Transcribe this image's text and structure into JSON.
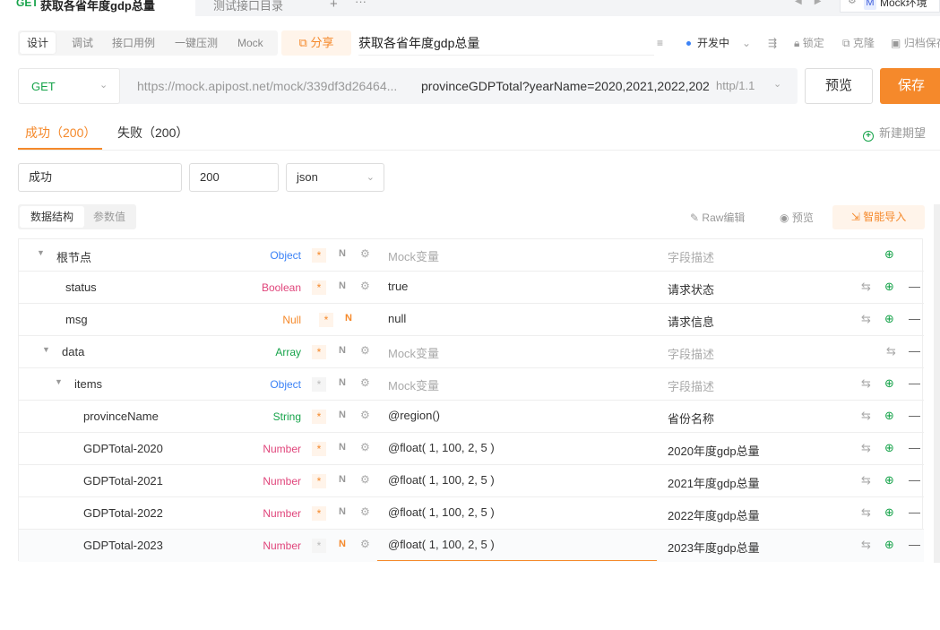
{
  "tabbar": {
    "active_method": "GET",
    "active_title": "获取各省年度gdp总量",
    "tab2_title": "测试接口目录",
    "plus": "+",
    "more": "···",
    "env_icon": "M",
    "env_name": "Mock环境"
  },
  "toolbar": {
    "subtabs": [
      "设计",
      "调试",
      "接口用例",
      "一键压测",
      "Mock"
    ],
    "share": "分享",
    "api_name": "获取各省年度gdp总量",
    "status": "开发中",
    "lock": "锁定",
    "clone": "克隆",
    "archive": "归档保存"
  },
  "urlbar": {
    "method": "GET",
    "host": "https://mock.apipost.net/mock/339df3d26464...",
    "path": "provinceGDPTotal?yearName=2020,2021,2022,202",
    "http_version": "http/1.1",
    "preview": "预览",
    "save": "保存"
  },
  "response": {
    "tabs": [
      "成功（200）",
      "失败（200）"
    ],
    "new_expect": "新建期望",
    "name": "成功",
    "code": "200",
    "format": "json",
    "seg": [
      "数据结构",
      "参数值"
    ],
    "raw_edit": "Raw编辑",
    "preview": "预览",
    "smart_import": "智能导入"
  },
  "colors": {
    "accent": "#f5892b",
    "get": "#16a34a",
    "object": "#3b82f6",
    "boolean": "#e0457b",
    "null": "#f5892b",
    "array": "#16a34a",
    "string": "#16a34a",
    "number": "#e0457b"
  },
  "tree": [
    {
      "name": "根节点",
      "type": "Object",
      "mock": "Mock变量",
      "desc": "字段描述"
    },
    {
      "name": "status",
      "type": "Boolean",
      "mock": "true",
      "desc": "请求状态"
    },
    {
      "name": "msg",
      "type": "Null",
      "mock": "null",
      "desc": "请求信息"
    },
    {
      "name": "data",
      "type": "Array",
      "mock": "Mock变量",
      "desc": "字段描述"
    },
    {
      "name": "items",
      "type": "Object",
      "mock": "Mock变量",
      "desc": "字段描述"
    },
    {
      "name": "provinceName",
      "type": "String",
      "mock": "@region()",
      "desc": "省份名称"
    },
    {
      "name": "GDPTotal-2020",
      "type": "Number",
      "mock": "@float( 1, 100, 2, 5 )",
      "desc": "2020年度gdp总量"
    },
    {
      "name": "GDPTotal-2021",
      "type": "Number",
      "mock": "@float( 1, 100, 2, 5 )",
      "desc": "2021年度gdp总量"
    },
    {
      "name": "GDPTotal-2022",
      "type": "Number",
      "mock": "@float( 1, 100, 2, 5 )",
      "desc": "2022年度gdp总量"
    },
    {
      "name": "GDPTotal-2023",
      "type": "Number",
      "mock": "@float( 1, 100, 2, 5 )",
      "desc": "2023年度gdp总量"
    }
  ],
  "glyphs": {
    "req": "*",
    "nullable": "N"
  }
}
